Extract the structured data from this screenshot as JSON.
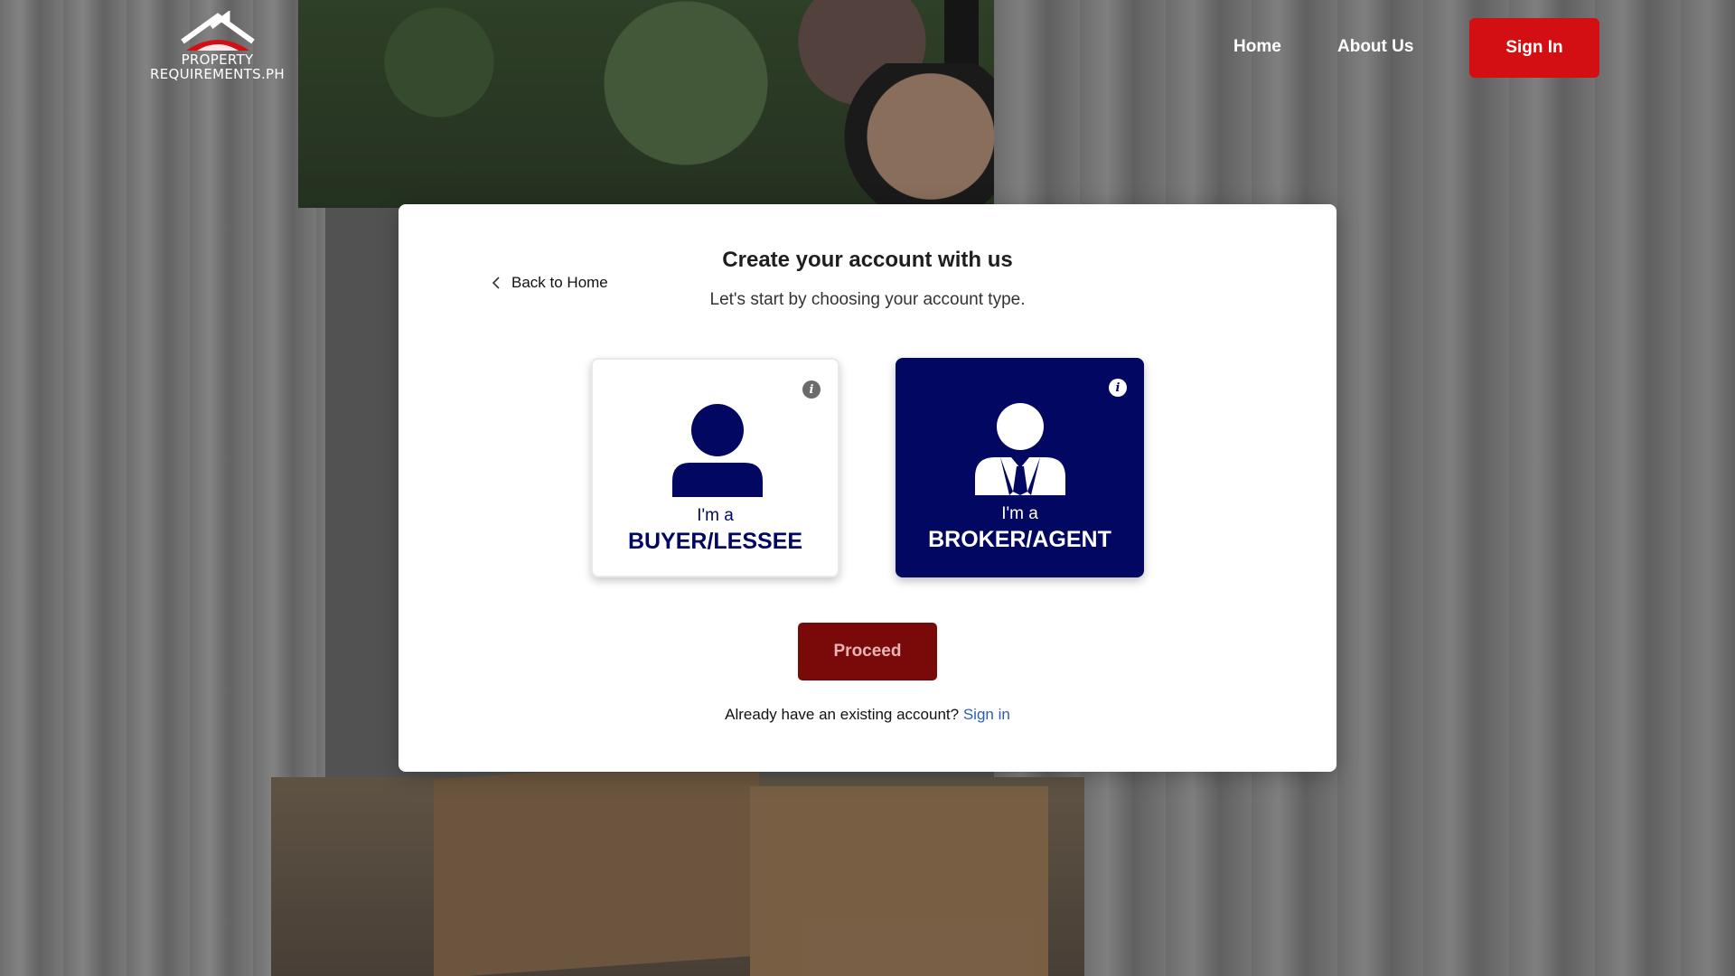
{
  "header": {
    "logo_line1": "PROPERTY",
    "logo_line2": "REQUIREMENTS.PH",
    "nav": {
      "home": "Home",
      "about": "About Us"
    },
    "sign_in": "Sign In",
    "brand_red": "#d40f14"
  },
  "modal": {
    "back_label": "Back to Home",
    "title": "Create your account with us",
    "subtitle": "Let's start by choosing your account type.",
    "cards": {
      "buyer": {
        "prefix": "I'm a",
        "role": "BUYER/LESSEE",
        "icon": "user-icon",
        "info_icon": "info-icon"
      },
      "broker": {
        "prefix": "I'm a",
        "role": "BROKER/AGENT",
        "icon": "user-tie-icon",
        "info_icon": "info-icon",
        "selected": true
      }
    },
    "proceed": "Proceed",
    "existing_text": "Already have an existing account?",
    "existing_link": "Sign in",
    "navy": "#020861",
    "link_blue": "#2b5cb8"
  }
}
